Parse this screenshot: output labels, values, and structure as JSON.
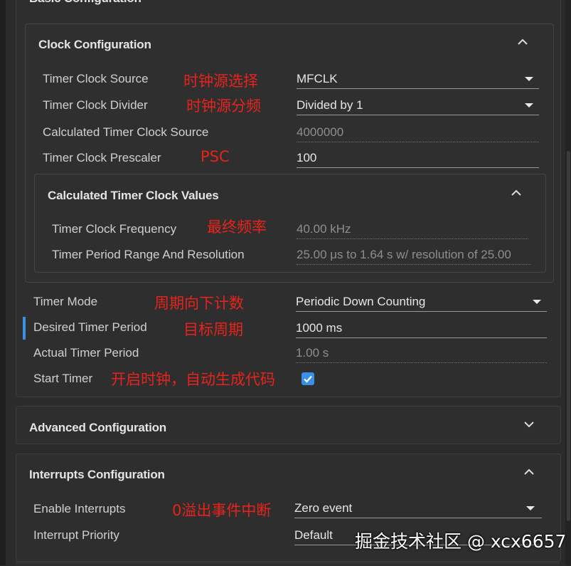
{
  "basic": {
    "title": "Basic Configuration"
  },
  "clock": {
    "title": "Clock Configuration",
    "source": {
      "label": "Timer Clock Source",
      "note": "时钟源选择",
      "value": "MFCLK"
    },
    "divider": {
      "label": "Timer Clock Divider",
      "note": "时钟源分频",
      "value": "Divided by 1"
    },
    "calc_source": {
      "label": "Calculated Timer Clock Source",
      "value": "4000000"
    },
    "prescaler": {
      "label": "Timer Clock Prescaler",
      "note": "PSC",
      "value": "100"
    },
    "calc": {
      "title": "Calculated Timer Clock Values",
      "frequency": {
        "label": "Timer Clock Frequency",
        "note": "最终频率",
        "value": "40.00 kHz"
      },
      "period_range": {
        "label": "Timer Period Range And Resolution",
        "value": "25.00 μs to 1.64 s w/ resolution of 25.00"
      }
    }
  },
  "timer": {
    "mode": {
      "label": "Timer Mode",
      "note": "周期向下计数",
      "value": "Periodic Down Counting"
    },
    "desired": {
      "label": "Desired Timer Period",
      "note": "目标周期",
      "value": "1000 ms"
    },
    "actual": {
      "label": "Actual Timer Period",
      "value": "1.00 s"
    },
    "start": {
      "label": "Start Timer",
      "note": "开启时钟，自动生成代码",
      "checked": true
    }
  },
  "advanced": {
    "title": "Advanced Configuration"
  },
  "interrupts": {
    "title": "Interrupts Configuration",
    "enable": {
      "label": "Enable Interrupts",
      "note": "0溢出事件中断",
      "value": "Zero event"
    },
    "priority": {
      "label": "Interrupt Priority",
      "value": "Default"
    }
  },
  "watermark": "掘金技术社区 @ xcx6657",
  "colors": {
    "accent": "#3b8fe6",
    "annotation": "#e8231c",
    "background": "#2b2b2b"
  },
  "icons": [
    "chevron-up-icon",
    "chevron-down-icon",
    "dropdown-caret-icon",
    "checkmark-icon"
  ]
}
